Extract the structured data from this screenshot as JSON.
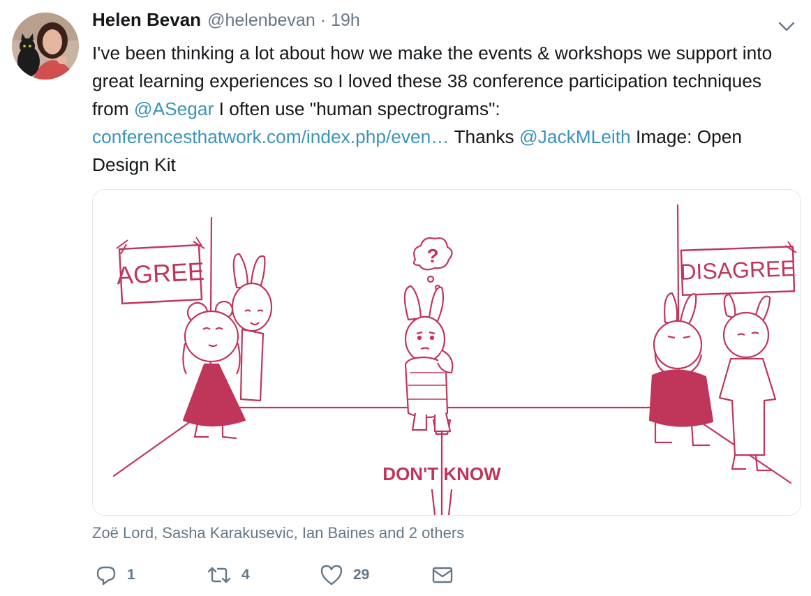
{
  "tweet": {
    "author_name": "Helen Bevan",
    "author_handle": "@helenbevan",
    "separator": "·",
    "time": "19h",
    "text_parts": [
      "I've been thinking a lot about how we make the events & workshops we support into great learning experiences so I loved these 38 conference participation techniques from ",
      "@ASegar",
      " I often use \"human spectrograms\": ",
      "conferencesthatwork.com/index.php/even…",
      " Thanks ",
      "@JackMLeith",
      " Image: Open Design Kit"
    ],
    "image": {
      "agree_sign": "AGREE",
      "disagree_sign": "DISAGREE",
      "dont_know_label": "DON'T KNOW",
      "question_mark": "?"
    },
    "tagged_users": "Zoë Lord, Sasha Karakusevic, Ian Baines and 2 others",
    "actions": {
      "reply_count": "1",
      "retweet_count": "4",
      "like_count": "29"
    }
  },
  "icons": {
    "caret": "chevron-down-icon",
    "reply": "reply-icon",
    "retweet": "retweet-icon",
    "like": "heart-icon",
    "dm": "envelope-icon"
  },
  "colors": {
    "link": "#3b94b6",
    "secondary": "#657786",
    "illustration": "#c0355a"
  }
}
